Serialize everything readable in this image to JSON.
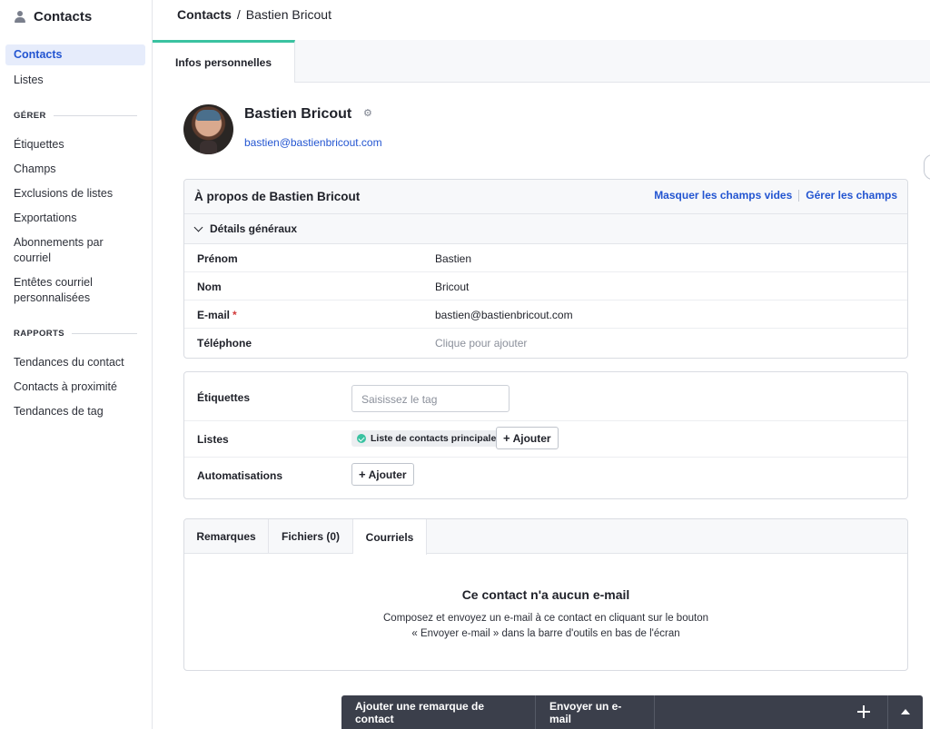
{
  "sidebar": {
    "app_title": "Contacts",
    "items": [
      {
        "label": "Contacts"
      },
      {
        "label": "Listes"
      }
    ],
    "manage_section": "GÉRER",
    "manage_items": [
      {
        "label": "Étiquettes"
      },
      {
        "label": "Champs"
      },
      {
        "label": "Exclusions de listes"
      },
      {
        "label": "Exportations"
      },
      {
        "label": "Abonnements par\ncourriel"
      },
      {
        "label": "Entêtes courriel\npersonnalisées"
      }
    ],
    "reports_section": "RAPPORTS",
    "report_items": [
      {
        "label": "Tendances du contact"
      },
      {
        "label": "Contacts à proximité"
      },
      {
        "label": "Tendances de tag"
      }
    ]
  },
  "header": {
    "breadcrumb_root": "Contacts",
    "breadcrumb_sep": "/",
    "breadcrumb_current": "Bastien Bricout"
  },
  "tabs": {
    "active": "Infos personnelles"
  },
  "profile": {
    "name": "Bastien Bricout",
    "email": "bastien@bastienbricout.com"
  },
  "about": {
    "title": "À propos de Bastien Bricout",
    "hide_empty": "Masquer les champs vides",
    "manage_fields": "Gérer les champs",
    "section": "Détails généraux",
    "fields": [
      {
        "label": "Prénom",
        "value": "Bastien"
      },
      {
        "label": "Nom",
        "value": "Bricout"
      },
      {
        "label": "E-mail",
        "required": "*",
        "value": "bastien@bastienbricout.com"
      },
      {
        "label": "Téléphone",
        "value": "Clique pour ajouter"
      }
    ]
  },
  "tags": {
    "tags_label": "Étiquettes",
    "tag_placeholder": "Saisissez le tag",
    "lists_label": "Listes",
    "list_chip": "Liste de contacts principale",
    "add_label": "Ajouter",
    "automations_label": "Automatisations"
  },
  "notes": {
    "tabs": [
      {
        "label": "Remarques"
      },
      {
        "label": "Fichiers (0)"
      },
      {
        "label": "Courriels"
      }
    ],
    "empty_title": "Ce contact n'a aucun e-mail",
    "empty_line1": "Composez et envoyez un e-mail à ce contact en cliquant sur le bouton",
    "empty_line2": "« Envoyer e-mail » dans la barre d'outils en bas de l'écran"
  },
  "action_bar": {
    "add_note": "Ajouter une remarque de contact",
    "send_email": "Envoyer un e-mail"
  },
  "colors": {
    "accent": "#2355d1",
    "tab_active_border": "#3ac2a1",
    "action_bar": "#3b3f4b"
  }
}
